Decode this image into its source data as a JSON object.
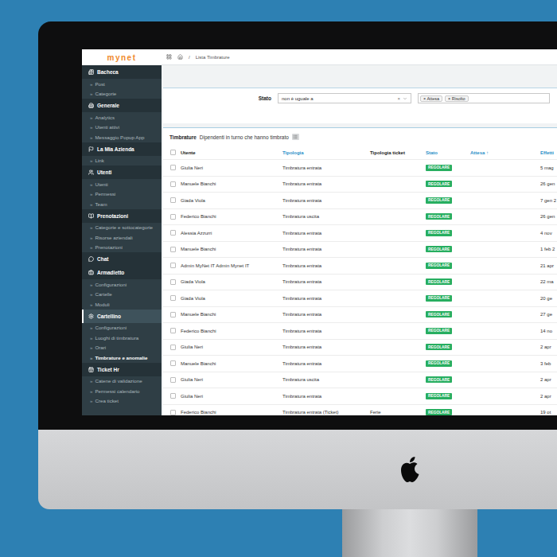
{
  "logo": "mynet",
  "breadcrumb": {
    "separator": "/",
    "current": "Lista Timbrature"
  },
  "sidebar": {
    "bullet": "»",
    "items": [
      {
        "label": "Bacheca",
        "kind": "section",
        "selected": false
      },
      {
        "label": "Post",
        "kind": "link",
        "selected": false
      },
      {
        "label": "Categorie",
        "kind": "link",
        "selected": false
      },
      {
        "label": "Generale",
        "kind": "section",
        "selected": false
      },
      {
        "label": "Analytics",
        "kind": "link",
        "selected": false
      },
      {
        "label": "Utenti attivi",
        "kind": "link",
        "selected": false
      },
      {
        "label": "Messaggio Popup App",
        "kind": "link",
        "selected": false
      },
      {
        "label": "La Mia Azienda",
        "kind": "section",
        "selected": false
      },
      {
        "label": "Link",
        "kind": "link",
        "selected": false
      },
      {
        "label": "Utenti",
        "kind": "section",
        "selected": false
      },
      {
        "label": "Utenti",
        "kind": "link",
        "selected": false
      },
      {
        "label": "Permessi",
        "kind": "link",
        "selected": false
      },
      {
        "label": "Team",
        "kind": "link",
        "selected": false
      },
      {
        "label": "Prenotazioni",
        "kind": "section",
        "selected": false
      },
      {
        "label": "Categorie e sottocategorie",
        "kind": "link",
        "selected": false
      },
      {
        "label": "Risorse aziendali",
        "kind": "link",
        "selected": false
      },
      {
        "label": "Prenotazioni",
        "kind": "link",
        "selected": false
      },
      {
        "label": "Chat",
        "kind": "section",
        "selected": false
      },
      {
        "label": "Armadietto",
        "kind": "section",
        "selected": false
      },
      {
        "label": "Configurazioni",
        "kind": "link",
        "selected": false
      },
      {
        "label": "Cartelle",
        "kind": "link",
        "selected": false
      },
      {
        "label": "Moduli",
        "kind": "link",
        "selected": false
      },
      {
        "label": "Cartellino",
        "kind": "section",
        "selected": true
      },
      {
        "label": "Configurazioni",
        "kind": "link",
        "selected": false
      },
      {
        "label": "Luoghi di timbratura",
        "kind": "link",
        "selected": false
      },
      {
        "label": "Orari",
        "kind": "link",
        "selected": false
      },
      {
        "label": "Timbrature e anomalie",
        "kind": "link",
        "selected": true
      },
      {
        "label": "Ticket Hr",
        "kind": "section",
        "selected": false
      },
      {
        "label": "Catene di validazione",
        "kind": "link",
        "selected": false
      },
      {
        "label": "Permessi calendario",
        "kind": "link",
        "selected": false
      },
      {
        "label": "Crea ticket",
        "kind": "link",
        "selected": false
      }
    ]
  },
  "filter": {
    "label": "Stato",
    "operator": "non è uguale a",
    "clear": "×",
    "tags": [
      {
        "label": "Attesa",
        "remove": "×"
      },
      {
        "label": "Risolto",
        "remove": "×"
      }
    ]
  },
  "table": {
    "title": "Timbrature",
    "subtitle": "Dipendenti in turno che hanno timbrato",
    "select_all": false,
    "sort_mark": "↑",
    "columns": [
      {
        "label": "Utente",
        "kind": "text",
        "sortable": false,
        "sorted": false
      },
      {
        "label": "Tipologia",
        "kind": "text",
        "sortable": true,
        "sorted": false
      },
      {
        "label": "Tipologia ticket",
        "kind": "text",
        "sortable": false,
        "sorted": false
      },
      {
        "label": "Stato",
        "kind": "badge",
        "sortable": true,
        "sorted": false
      },
      {
        "label": "Attesa",
        "kind": "text",
        "sortable": true,
        "sorted": true
      },
      {
        "label": "Effetti",
        "kind": "text",
        "sortable": true,
        "sorted": false
      }
    ],
    "rows": [
      {
        "checked": false,
        "cells": [
          "Giulia Neri",
          "Timbratura entrata",
          "",
          "REGOLARE",
          "",
          "5 mag"
        ]
      },
      {
        "checked": false,
        "cells": [
          "Manuele Bianchi",
          "Timbratura entrata",
          "",
          "REGOLARE",
          "",
          "26 gen"
        ]
      },
      {
        "checked": false,
        "cells": [
          "Giada Viola",
          "Timbratura entrata",
          "",
          "REGOLARE",
          "",
          "7 gen 2"
        ]
      },
      {
        "checked": false,
        "cells": [
          "Federico Bianchi",
          "Timbratura uscita",
          "",
          "REGOLARE",
          "",
          "26 gen"
        ]
      },
      {
        "checked": false,
        "cells": [
          "Alessia Azzurri",
          "Timbratura entrata",
          "",
          "REGOLARE",
          "",
          "4 nov"
        ]
      },
      {
        "checked": false,
        "cells": [
          "Manuele Bianchi",
          "Timbratura entrata",
          "",
          "REGOLARE",
          "",
          "1 feb 2"
        ]
      },
      {
        "checked": false,
        "cells": [
          "Admin MyNet IT Admin Mynet IT",
          "Timbratura entrata",
          "",
          "REGOLARE",
          "",
          "21 apr"
        ]
      },
      {
        "checked": false,
        "cells": [
          "Giada Viola",
          "Timbratura entrata",
          "",
          "REGOLARE",
          "",
          "22 ma"
        ]
      },
      {
        "checked": false,
        "cells": [
          "Giada Viola",
          "Timbratura entrata",
          "",
          "REGOLARE",
          "",
          "20 ge"
        ]
      },
      {
        "checked": false,
        "cells": [
          "Manuele Bianchi",
          "Timbratura entrata",
          "",
          "REGOLARE",
          "",
          "27 ge"
        ]
      },
      {
        "checked": false,
        "cells": [
          "Federico Bianchi",
          "Timbratura entrata",
          "",
          "REGOLARE",
          "",
          "14 no"
        ]
      },
      {
        "checked": false,
        "cells": [
          "Giulia Neri",
          "Timbratura entrata",
          "",
          "REGOLARE",
          "",
          "2 apr"
        ]
      },
      {
        "checked": false,
        "cells": [
          "Manuele Bianchi",
          "Timbratura entrata",
          "",
          "REGOLARE",
          "",
          "3 feb"
        ]
      },
      {
        "checked": false,
        "cells": [
          "Giulia Neri",
          "Timbratura uscita",
          "",
          "REGOLARE",
          "",
          "2 apr"
        ]
      },
      {
        "checked": false,
        "cells": [
          "Giulia Neri",
          "Timbratura entrata",
          "",
          "REGOLARE",
          "",
          "2 apr"
        ]
      },
      {
        "checked": false,
        "cells": [
          "Federico Bianchi",
          "Timbratura entrata (Ticket)",
          "Ferie",
          "REGOLARE",
          "",
          "19 ot"
        ]
      }
    ]
  }
}
